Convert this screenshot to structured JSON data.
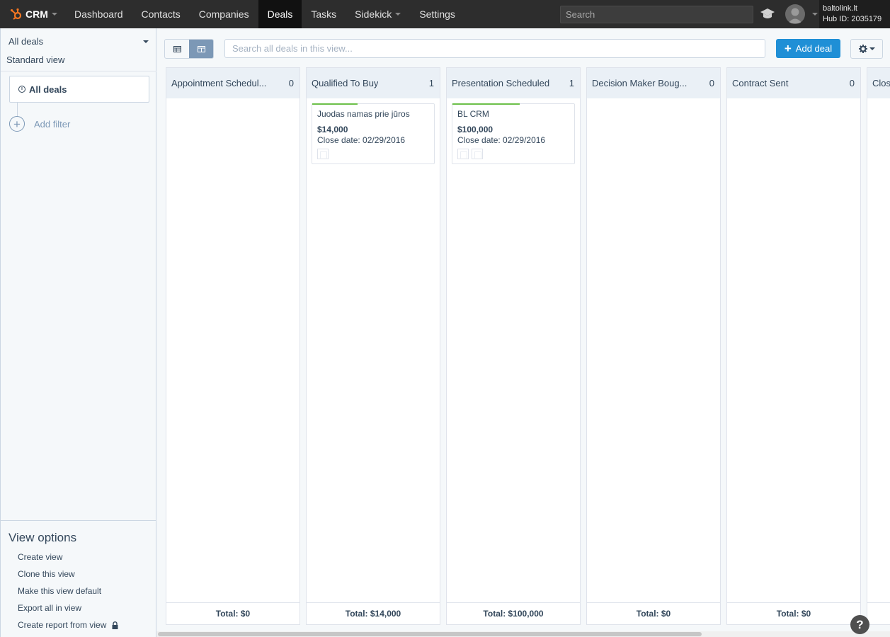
{
  "topnav": {
    "brand": "CRM",
    "items": [
      {
        "label": "Dashboard",
        "active": false
      },
      {
        "label": "Contacts",
        "active": false
      },
      {
        "label": "Companies",
        "active": false
      },
      {
        "label": "Deals",
        "active": true
      },
      {
        "label": "Tasks",
        "active": false
      },
      {
        "label": "Sidekick",
        "active": false
      },
      {
        "label": "Settings",
        "active": false
      }
    ],
    "search_placeholder": "Search",
    "account_name": "baltolink.lt",
    "hub_id": "Hub ID: 2035179"
  },
  "sidebar": {
    "selected_view": "All deals",
    "view_type": "Standard view",
    "filter_label": "All deals",
    "add_filter": "Add filter",
    "view_options_title": "View options",
    "view_options": [
      "Create view",
      "Clone this view",
      "Make this view default",
      "Export all in view",
      "Create report from view"
    ]
  },
  "toolbar": {
    "search_placeholder": "Search all deals in this view...",
    "add_deal": "Add deal"
  },
  "board": {
    "columns": [
      {
        "name": "Appointment Schedul...",
        "count": "0",
        "total": "Total: $0",
        "deals": []
      },
      {
        "name": "Qualified To Buy",
        "count": "1",
        "total": "Total: $14,000",
        "deals": [
          {
            "name": "Juodas namas prie jūros",
            "amount": "$14,000",
            "close_date": "Close date: 02/29/2016",
            "contacts": 1,
            "progress": 0.37
          }
        ]
      },
      {
        "name": "Presentation Scheduled",
        "count": "1",
        "total": "Total: $100,000",
        "deals": [
          {
            "name": "BL CRM",
            "amount": "$100,000",
            "close_date": "Close date: 02/29/2016",
            "contacts": 2,
            "progress": 0.55
          }
        ]
      },
      {
        "name": "Decision Maker Boug...",
        "count": "0",
        "total": "Total: $0",
        "deals": []
      },
      {
        "name": "Contract Sent",
        "count": "0",
        "total": "Total: $0",
        "deals": []
      },
      {
        "name": "Clos",
        "count": "",
        "total": "",
        "deals": []
      }
    ]
  },
  "help_label": "?",
  "colors": {
    "accent": "#1f8fd6",
    "nav_bg": "#2d2d2d",
    "progress": "#6cc04a",
    "logo": "#f57722"
  }
}
